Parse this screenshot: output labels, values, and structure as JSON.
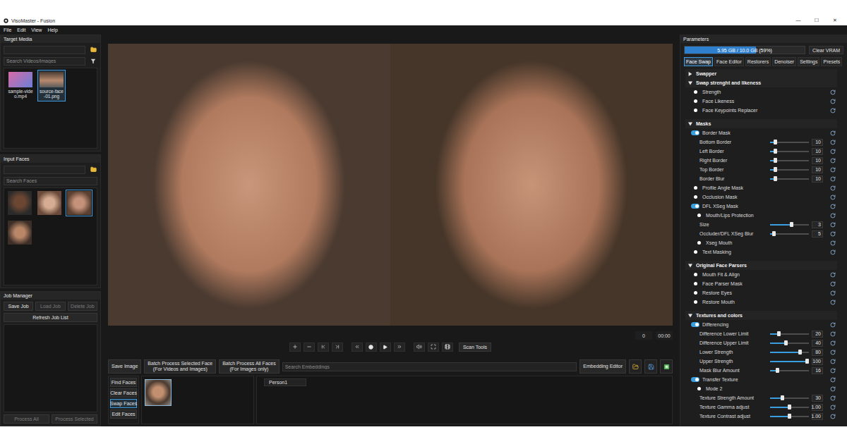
{
  "window": {
    "title": "VisoMaster - Fusion",
    "controls": [
      "—",
      "☐",
      "✕"
    ]
  },
  "menu": [
    "File",
    "Edit",
    "View",
    "Help"
  ],
  "target_media": {
    "title": "Target Media",
    "path": {
      "value": ""
    },
    "search": {
      "placeholder": "Search Videos/Images"
    },
    "items": [
      {
        "label": "sample-video.mp4",
        "selected": false
      },
      {
        "label": "source-face-01.png",
        "selected": true
      }
    ]
  },
  "input_faces": {
    "title": "Input Faces",
    "path": {
      "value": ""
    },
    "search": {
      "placeholder": "Search Faces"
    },
    "faces": [
      {
        "selected": false
      },
      {
        "selected": false
      },
      {
        "selected": true
      },
      {
        "selected": false
      }
    ]
  },
  "job_manager": {
    "title": "Job Manager",
    "buttons": [
      {
        "label": "Save Job",
        "disabled": false
      },
      {
        "label": "Load Job",
        "disabled": true
      },
      {
        "label": "Delete Job",
        "disabled": true
      }
    ],
    "refresh": "Refresh Job List",
    "jobs": [],
    "footer": [
      {
        "label": "Process All",
        "disabled": true
      },
      {
        "label": "Process Selected",
        "disabled": true
      }
    ]
  },
  "player": {
    "frame": "0",
    "time": "00:00",
    "scan_tools": "Scan Tools"
  },
  "actions": {
    "save_image": "Save Image",
    "batch": [
      {
        "lines": [
          "Batch Process Selected Face",
          "(For Videos and Images)"
        ]
      },
      {
        "lines": [
          "Batch Process All Faces",
          "(For Images only)"
        ]
      }
    ]
  },
  "face_tools": [
    {
      "label": "Find Faces",
      "selected": false
    },
    {
      "label": "Clear Faces",
      "selected": false
    },
    {
      "label": "Swap Faces",
      "selected": true
    },
    {
      "label": "Edit Faces",
      "selected": false
    }
  ],
  "detected_faces": [
    {
      "selected": true
    }
  ],
  "embeddings": {
    "search": {
      "placeholder": "Search Embeddings"
    },
    "editor": "Embedding Editor",
    "items": [
      {
        "label": "Person1",
        "selected": false
      }
    ]
  },
  "parameters": {
    "title": "Parameters",
    "vram": {
      "reading": "5.95 GB / 10.0 GB (59%)",
      "level": 0.595
    },
    "clear": "Clear VRAM",
    "tabs": [
      {
        "label": "Face Swap",
        "selected": true
      },
      {
        "label": "Face Editor",
        "selected": false
      },
      {
        "label": "Restorers",
        "selected": false
      },
      {
        "label": "Denoiser",
        "selected": false
      },
      {
        "label": "Settings",
        "selected": false
      },
      {
        "label": "Presets",
        "selected": false
      }
    ],
    "sections": [
      {
        "title": "Swapper",
        "expanded": false,
        "rows": []
      },
      {
        "title": "Swap strenght and likeness",
        "expanded": true,
        "rows": [
          {
            "kind": "toggle",
            "label": "Strength",
            "on": false
          },
          {
            "kind": "toggle",
            "label": "Face Likeness",
            "on": false
          },
          {
            "kind": "toggle",
            "label": "Face Keypoints Replacer",
            "on": false
          }
        ]
      },
      {
        "title": "Masks",
        "expanded": true,
        "rows": [
          {
            "kind": "toggle",
            "label": "Border Mask",
            "on": true
          },
          {
            "kind": "slider",
            "label": "Bottom Border",
            "value": "10",
            "level": 0.1
          },
          {
            "kind": "slider",
            "label": "Left Border",
            "value": "10",
            "level": 0.1
          },
          {
            "kind": "slider",
            "label": "Right Border",
            "value": "10",
            "level": 0.1
          },
          {
            "kind": "slider",
            "label": "Top Border",
            "value": "10",
            "level": 0.1
          },
          {
            "kind": "slider",
            "label": "Border Blur",
            "value": "10",
            "level": 0.1
          },
          {
            "kind": "toggle",
            "label": "Profile Angle Mask",
            "on": false
          },
          {
            "kind": "toggle",
            "label": "Occlusion Mask",
            "on": false
          },
          {
            "kind": "toggle",
            "label": "DFL XSeg Mask",
            "on": true
          },
          {
            "kind": "subtoggle",
            "label": "Mouth/Lips Protection",
            "on": false
          },
          {
            "kind": "slider",
            "label": "Size",
            "value": "3",
            "level": 0.55
          },
          {
            "kind": "slider",
            "label": "Occluder/DFL XSeg Blur",
            "value": "5",
            "level": 0.05
          },
          {
            "kind": "subtoggle",
            "label": "Xseg Mouth",
            "on": false
          },
          {
            "kind": "toggle",
            "label": "Text Masking",
            "on": false
          }
        ]
      },
      {
        "title": "Original Face Parsers",
        "expanded": true,
        "rows": [
          {
            "kind": "toggle",
            "label": "Mouth Fit & Align",
            "on": false
          },
          {
            "kind": "toggle",
            "label": "Face Parser Mask",
            "on": false
          },
          {
            "kind": "toggle",
            "label": "Restore Eyes",
            "on": false
          },
          {
            "kind": "toggle",
            "label": "Restore Mouth",
            "on": false
          }
        ]
      },
      {
        "title": "Textures and colors",
        "expanded": true,
        "rows": [
          {
            "kind": "toggle",
            "label": "Differencing",
            "on": true
          },
          {
            "kind": "slider",
            "label": "Difference Lower Limit",
            "value": "20",
            "level": 0.2
          },
          {
            "kind": "slider",
            "label": "Difference Upper Limit",
            "value": "40",
            "level": 0.4
          },
          {
            "kind": "slider",
            "label": "Lower Strength",
            "value": "80",
            "level": 0.8
          },
          {
            "kind": "slider",
            "label": "Upper Strength",
            "value": "100",
            "level": 1.0
          },
          {
            "kind": "slider",
            "label": "Mask Blur Amount",
            "value": "16",
            "level": 0.16
          },
          {
            "kind": "toggle",
            "label": "Transfer Texture",
            "on": true
          },
          {
            "kind": "subtoggle",
            "label": "Mode 2",
            "on": false
          },
          {
            "kind": "slider",
            "label": "Texture Strength Amount",
            "value": "30",
            "level": 0.3
          },
          {
            "kind": "slider",
            "label": "Texture Gamma adjust",
            "value": "1.00",
            "level": 0.5
          },
          {
            "kind": "slider",
            "label": "Texture Contrast adjust",
            "value": "1.00",
            "level": 0.5
          }
        ]
      }
    ]
  }
}
